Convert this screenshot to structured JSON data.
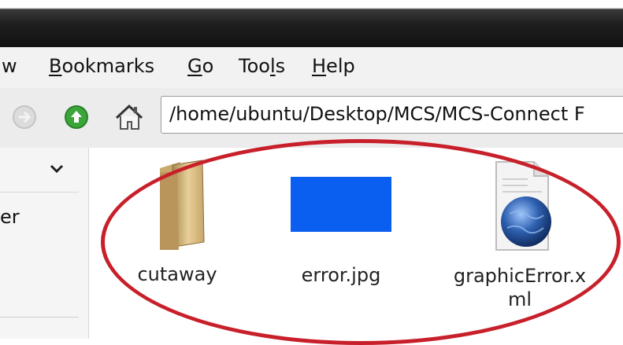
{
  "menu": [
    {
      "label": "w",
      "accel": ""
    },
    {
      "label": "Bookmarks",
      "accel": "B"
    },
    {
      "label": "Go",
      "accel": "G"
    },
    {
      "label": "Tools",
      "accel": "l"
    },
    {
      "label": "Help",
      "accel": "H"
    }
  ],
  "location": {
    "path": "/home/ubuntu/Desktop/MCS/MCS-Connect F"
  },
  "sidebar": {
    "partial_text": "er"
  },
  "files": [
    {
      "name": "cutaway",
      "type": "folder"
    },
    {
      "name": "error.jpg",
      "type": "image"
    },
    {
      "name_line1": "graphicError.x",
      "name_line2": "ml",
      "type": "xml-document"
    }
  ],
  "colors": {
    "highlight_ellipse": "#c8202a",
    "image_thumb": "#0a5ef0",
    "up_button": "#3aa63a"
  }
}
